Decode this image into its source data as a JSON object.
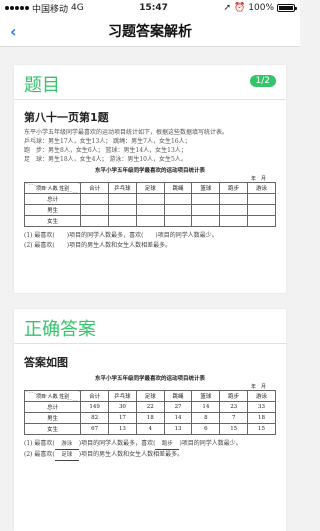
{
  "status_bar": {
    "carrier": "中国移动",
    "network": "4G",
    "time": "15:47",
    "battery": "100%",
    "battery_level": 1.0
  },
  "nav": {
    "back_glyph": "‹",
    "title": "习题答案解析"
  },
  "question_card": {
    "title": "题目",
    "badge": "1/2",
    "question_title": "第八十一页第1题",
    "problem_text": [
      "东平小学五年级同学最喜欢的运动项目统计如下，根据这些数据填写统计表。",
      "乒乓球：男生17人，女生13人；   跳绳：男生7人，女生16人；",
      "跑　步：男生8人，女生6人；   篮球：男生14人，女生13人；",
      "足　球：男生18人，女生4人；   游泳：男生10人，女生5人。"
    ],
    "table_title": "东平小学五年级同学最喜欢的运动项目统计表",
    "table_date": "年　月",
    "diag_top": "项目",
    "diag_mid": "人数",
    "diag_bottom": "性别",
    "columns": [
      "合计",
      "乒乓球",
      "足球",
      "跳绳",
      "篮球",
      "跑步",
      "游泳"
    ],
    "row_labels": [
      "总计",
      "男生",
      "女生"
    ],
    "questions": [
      "(1) 最喜欢(　　)项目的同学人数最多，喜欢(　　)项目的同学人数最少。",
      "(2) 最喜欢(　　)项目的男生人数和女生人数相差最多。"
    ]
  },
  "answer_card": {
    "title": "正确答案",
    "answer_label": "答案如图",
    "table_title": "东平小学五年级同学最喜欢的运动项目统计表",
    "table_date": "年　月",
    "diag_top": "项目",
    "diag_mid": "人数",
    "diag_bottom": "性别",
    "columns": [
      "合计",
      "乒乓球",
      "足球",
      "跳绳",
      "篮球",
      "跑步",
      "游泳"
    ],
    "rows": [
      {
        "label": "总计",
        "values": [
          "149",
          "30",
          "22",
          "27",
          "14",
          "23",
          "33"
        ]
      },
      {
        "label": "男生",
        "values": [
          "82",
          "17",
          "18",
          "14",
          "8",
          "7",
          "18"
        ]
      },
      {
        "label": "女生",
        "values": [
          "67",
          "13",
          "4",
          "13",
          "6",
          "15",
          "15"
        ]
      }
    ],
    "q1_prefix": "(1) 最喜欢(",
    "q1_ans1": "游泳",
    "q1_mid": ")项目的同学人数最多，喜欢(",
    "q1_ans2": "跑步",
    "q1_suffix": ")项目的同学人数最少。",
    "q2_prefix": "(2) 最喜欢(",
    "q2_ans": "足球",
    "q2_suffix": ")项目的男生人数和女生人数相差最多。"
  }
}
